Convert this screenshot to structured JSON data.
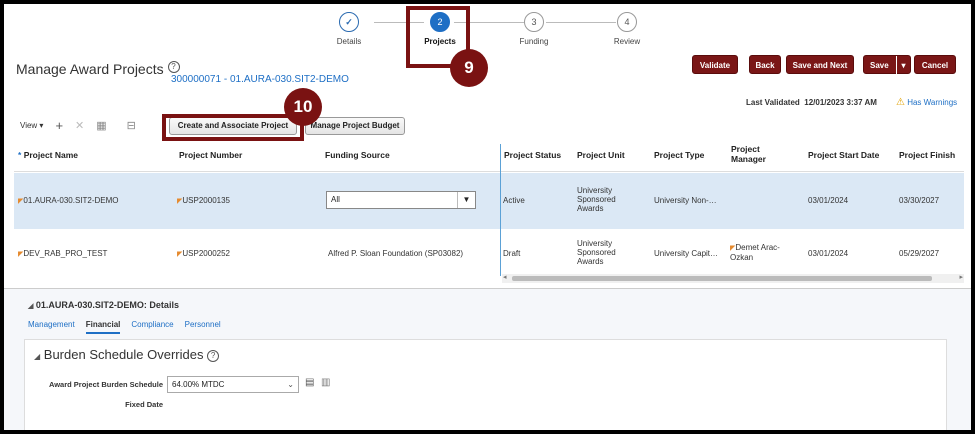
{
  "train": {
    "steps": [
      {
        "num": "✓",
        "label": "Details"
      },
      {
        "num": "2",
        "label": "Projects"
      },
      {
        "num": "3",
        "label": "Funding"
      },
      {
        "num": "4",
        "label": "Review"
      }
    ]
  },
  "callouts": {
    "projects_step": "9",
    "create_button": "10"
  },
  "header": {
    "title": "Manage Award Projects",
    "help_glyph": "?",
    "award_link": "300000071 - 01.AURA-030.SIT2-DEMO",
    "last_validated_label": "Last Validated",
    "last_validated_value": "12/01/2023 3:37 AM",
    "warning": "Has Warnings"
  },
  "actions": {
    "validate": "Validate",
    "back": "Back",
    "save_next": "Save and Next",
    "save": "Save",
    "cancel": "Cancel"
  },
  "toolbar": {
    "view": "View ▾",
    "create_associate": "Create and Associate Project",
    "manage_budget": "Manage Project Budget"
  },
  "table": {
    "required_mark": "*",
    "headers": [
      "Project Name",
      "Project Number",
      "Funding Source",
      "Project Status",
      "Project Unit",
      "Project Type",
      "Project Manager",
      "Project Start Date",
      "Project Finish"
    ],
    "rows": [
      {
        "name": "01.AURA-030.SIT2-DEMO",
        "number": "USP2000135",
        "funding": "All",
        "status": "Active",
        "unit": "University Sponsored Awards",
        "type": "University Non-…",
        "manager": "",
        "start": "03/01/2024",
        "finish": "03/30/2027"
      },
      {
        "name": "DEV_RAB_PRO_TEST",
        "number": "USP2000252",
        "funding": "Alfred P. Sloan Foundation (SP03082)",
        "status": "Draft",
        "unit": "University Sponsored Awards",
        "type": "University Capit…",
        "manager": "Demet Arac-Ozkan",
        "start": "03/01/2024",
        "finish": "05/29/2027"
      }
    ]
  },
  "details": {
    "title": "01.AURA-030.SIT2-DEMO: Details",
    "tabs": [
      "Management",
      "Financial",
      "Compliance",
      "Personnel"
    ],
    "section_title": "Burden Schedule Overrides",
    "burden_label": "Award Project Burden Schedule",
    "burden_value": "64.00% MTDC",
    "fixed_date_label": "Fixed Date"
  },
  "colors": {
    "accent": "#1e6fc5",
    "brand_button": "#7a1616",
    "selected_row": "#dbe8f5"
  }
}
